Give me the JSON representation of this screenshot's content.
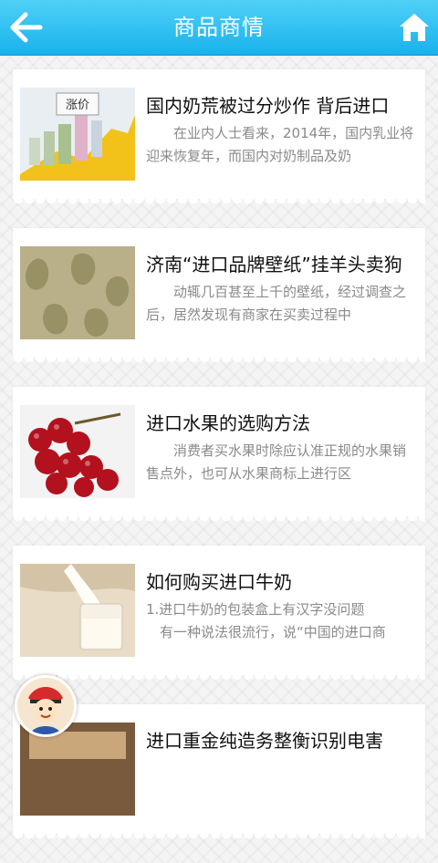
{
  "header": {
    "title": "商品商情",
    "back_icon": "arrow-left-icon",
    "home_icon": "home-icon"
  },
  "articles": [
    {
      "title": "国内奶荒被过分炒作 背后进口",
      "desc": "在业内人士看来，2014年，国内乳业将迎来恢复年，而国内对奶制品及奶",
      "thumb_label": "涨价"
    },
    {
      "title": "济南“进口品牌壁纸”挂羊头卖狗",
      "desc": "动辄几百甚至上千的壁纸，经过调查之后，居然发现有商家在买卖过程中"
    },
    {
      "title": "进口水果的选购方法",
      "desc": "消费者买水果时除应认准正规的水果销售点外，也可从水果商标上进行区"
    },
    {
      "title": "如何购买进口牛奶",
      "desc_line1": "1.进口牛奶的包装盒上有汉字没问题",
      "desc_line2": "有一种说法很流行，说“中国的进口商"
    },
    {
      "title": "进口重金纯造务整衡识别电害"
    }
  ],
  "colors": {
    "header_top": "#4fd0f7",
    "header_bottom": "#19b2ec",
    "title_text": "#111111",
    "desc_text": "#8a8a8a"
  }
}
